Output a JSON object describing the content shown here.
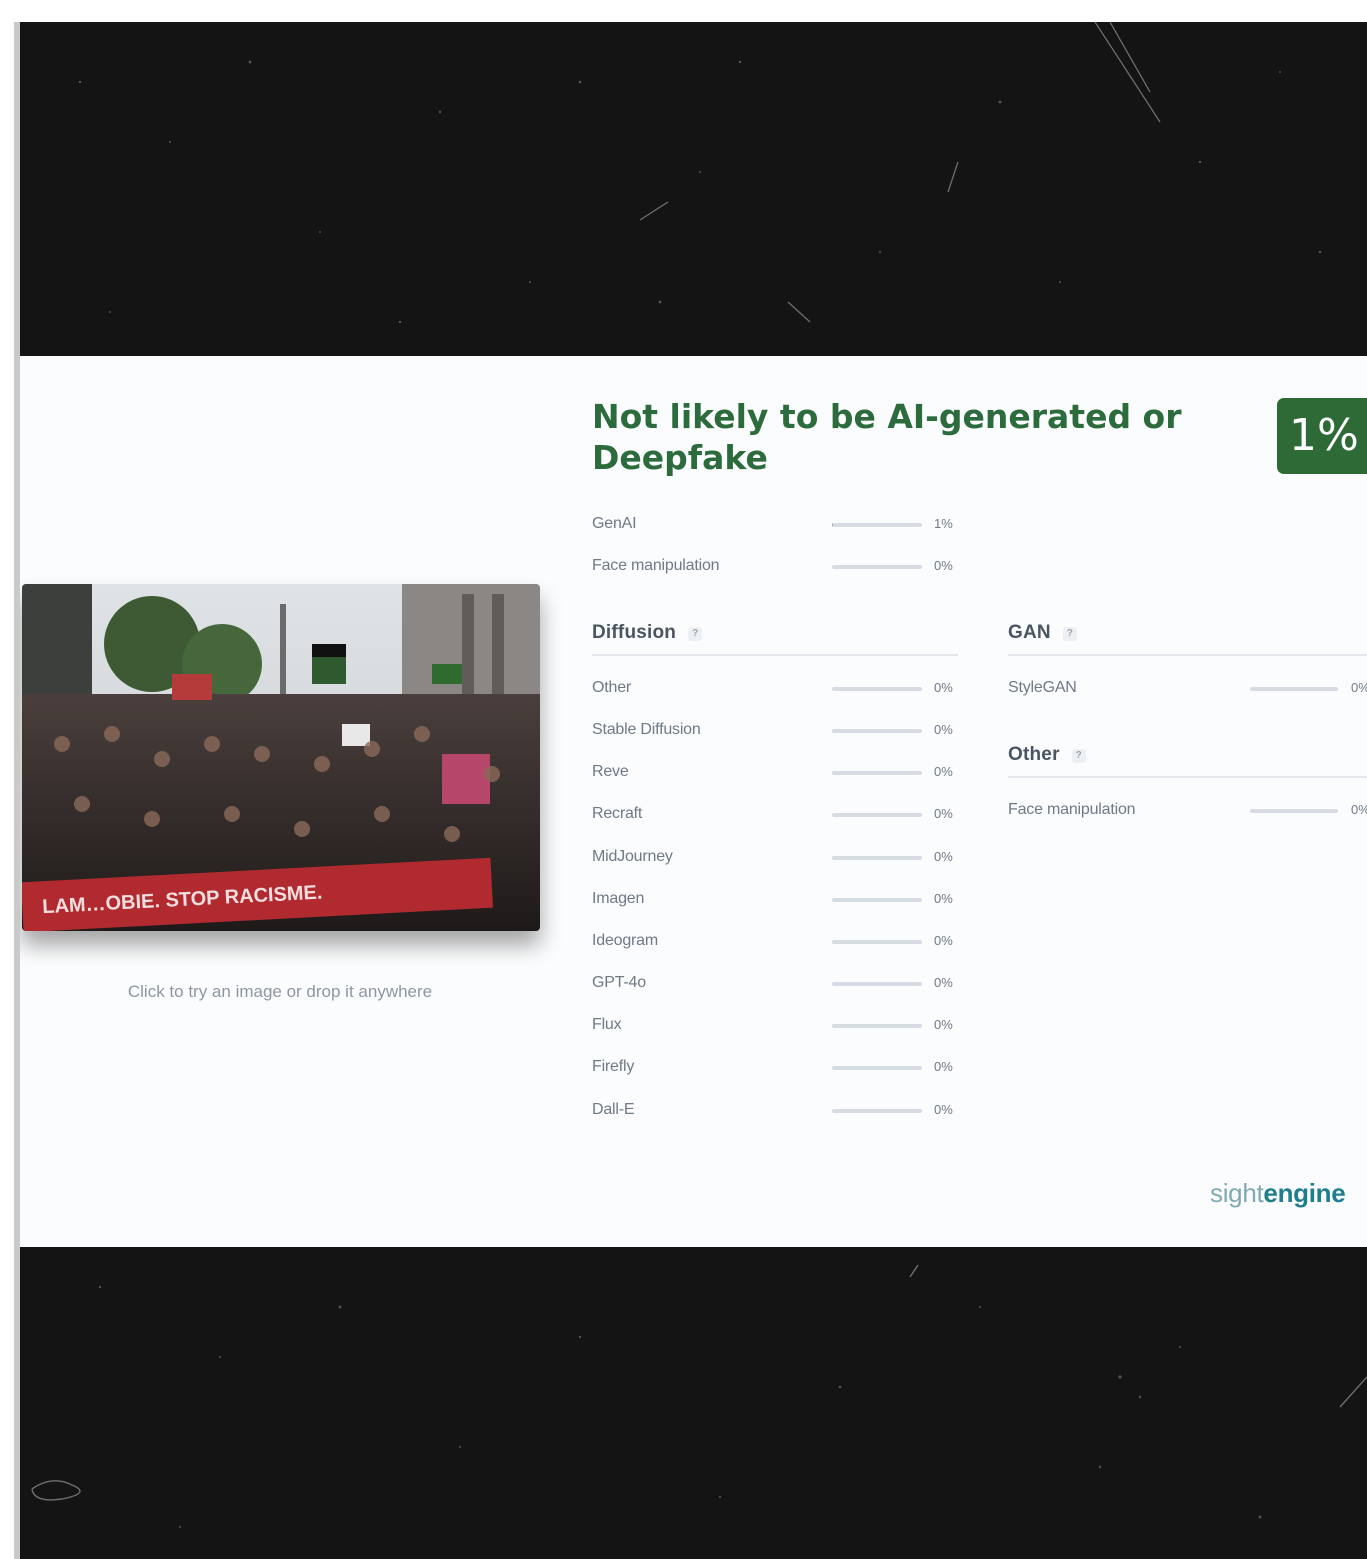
{
  "upload": {
    "hint": "Click to try an image or drop it anywhere",
    "image_caption": "LAM…OBIE. STOP RACISME."
  },
  "result": {
    "verdict": "Not likely to be AI-generated or Deepfake",
    "score": "1%",
    "accent_color": "#2d6a36"
  },
  "summary": [
    {
      "label": "GenAI",
      "value": "1%",
      "fraction": 0.01
    },
    {
      "label": "Face manipulation",
      "value": "0%",
      "fraction": 0
    }
  ],
  "diffusion": {
    "title": "Diffusion",
    "help": "?",
    "items": [
      {
        "label": "Other",
        "value": "0%",
        "fraction": 0
      },
      {
        "label": "Stable Diffusion",
        "value": "0%",
        "fraction": 0
      },
      {
        "label": "Reve",
        "value": "0%",
        "fraction": 0
      },
      {
        "label": "Recraft",
        "value": "0%",
        "fraction": 0
      },
      {
        "label": "MidJourney",
        "value": "0%",
        "fraction": 0
      },
      {
        "label": "Imagen",
        "value": "0%",
        "fraction": 0
      },
      {
        "label": "Ideogram",
        "value": "0%",
        "fraction": 0
      },
      {
        "label": "GPT-4o",
        "value": "0%",
        "fraction": 0
      },
      {
        "label": "Flux",
        "value": "0%",
        "fraction": 0
      },
      {
        "label": "Firefly",
        "value": "0%",
        "fraction": 0
      },
      {
        "label": "Dall-E",
        "value": "0%",
        "fraction": 0
      }
    ]
  },
  "gan": {
    "title": "GAN",
    "help": "?",
    "items": [
      {
        "label": "StyleGAN",
        "value": "0%",
        "fraction": 0
      }
    ]
  },
  "other": {
    "title": "Other",
    "help": "?",
    "items": [
      {
        "label": "Face manipulation",
        "value": "0%",
        "fraction": 0
      }
    ]
  },
  "brand": {
    "light": "sight",
    "bold": "engine"
  }
}
